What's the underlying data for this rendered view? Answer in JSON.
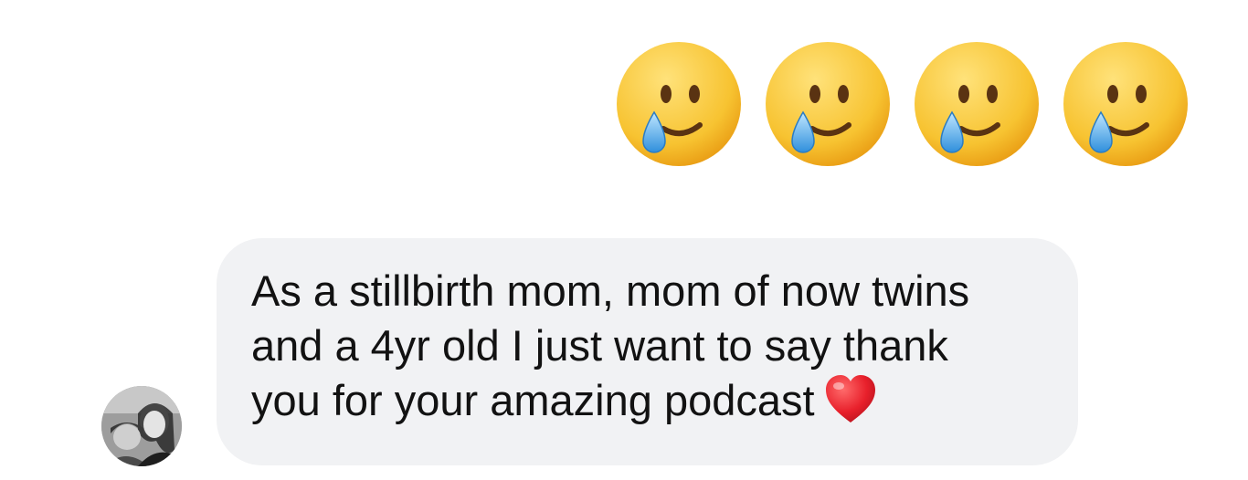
{
  "reactions": {
    "emoji_icon": "smiling-face-with-tear-icon",
    "count": 4
  },
  "message": {
    "lines": [
      "As a stillbirth mom, mom of now twins",
      "and a 4yr old I just want to say thank",
      "you for your amazing podcast"
    ],
    "trailing_icon": "red-heart-icon"
  },
  "sender": {
    "avatar_icon": "profile-photo"
  },
  "colors": {
    "bubble_background": "#f1f2f4",
    "text": "#121212",
    "heart": "#e8202b",
    "emoji_face": "#f7c331",
    "tear": "#5aa9e6"
  }
}
